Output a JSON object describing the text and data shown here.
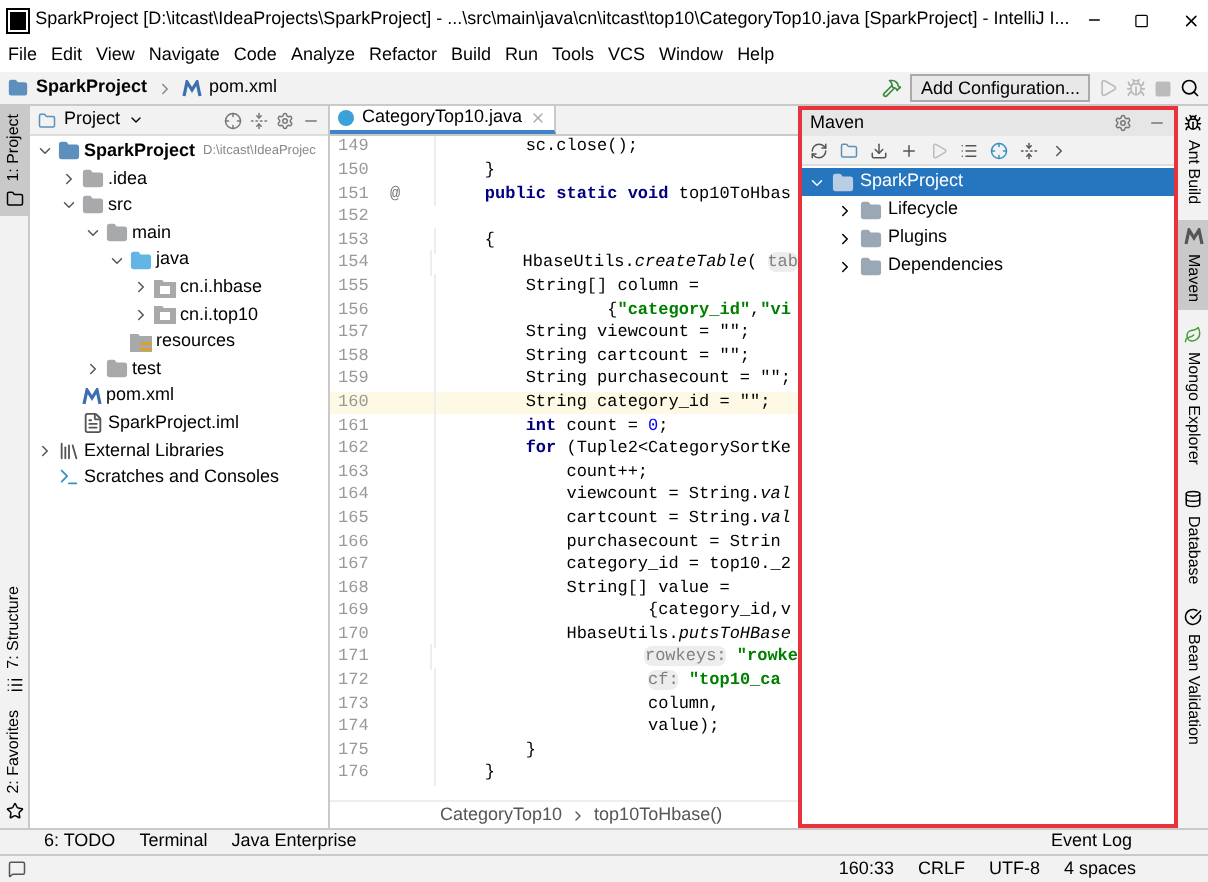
{
  "window": {
    "title": "SparkProject [D:\\itcast\\IdeaProjects\\SparkProject] - ...\\src\\main\\java\\cn\\itcast\\top10\\CategoryTop10.java [SparkProject] - IntelliJ I..."
  },
  "menu": [
    "File",
    "Edit",
    "View",
    "Navigate",
    "Code",
    "Analyze",
    "Refactor",
    "Build",
    "Run",
    "Tools",
    "VCS",
    "Window",
    "Help"
  ],
  "navbar": {
    "project": "SparkProject",
    "file": "pom.xml",
    "run_config": "Add Configuration..."
  },
  "left_tabs": [
    {
      "label": "1: Project",
      "selected": true
    },
    {
      "label": "7: Structure",
      "selected": false
    },
    {
      "label": "2: Favorites",
      "selected": false
    }
  ],
  "project_panel": {
    "title": "Project",
    "tree": [
      {
        "label": "SparkProject",
        "path": "D:\\itcast\\IdeaProjec",
        "kind": "module",
        "expanded": true,
        "children": [
          {
            "label": ".idea",
            "kind": "folder",
            "expanded": false
          },
          {
            "label": "src",
            "kind": "folder",
            "expanded": true,
            "children": [
              {
                "label": "main",
                "kind": "folder",
                "expanded": true,
                "children": [
                  {
                    "label": "java",
                    "kind": "source",
                    "expanded": true,
                    "children": [
                      {
                        "label": "cn.i.hbase",
                        "kind": "package",
                        "expanded": false
                      },
                      {
                        "label": "cn.i.top10",
                        "kind": "package",
                        "expanded": false
                      }
                    ]
                  },
                  {
                    "label": "resources",
                    "kind": "resources"
                  }
                ]
              },
              {
                "label": "test",
                "kind": "folder",
                "expanded": false
              }
            ]
          },
          {
            "label": "pom.xml",
            "kind": "maven"
          },
          {
            "label": "SparkProject.iml",
            "kind": "iml"
          }
        ]
      },
      {
        "label": "External Libraries",
        "kind": "libraries",
        "expanded": false
      },
      {
        "label": "Scratches and Consoles",
        "kind": "scratches"
      }
    ]
  },
  "editor": {
    "tab": "CategoryTop10.java",
    "lines": [
      {
        "n": "149",
        "code": [
          {
            "t": "        sc.close();",
            "kind": "plain"
          }
        ]
      },
      {
        "n": "150",
        "code": [
          {
            "t": "    }",
            "kind": "plain"
          }
        ]
      },
      {
        "n": "151",
        "mark": "@",
        "code": [
          {
            "t": "    public static void",
            "kind": "kw"
          },
          {
            "t": " top10ToHbas",
            "kind": "plain"
          }
        ]
      },
      {
        "n": "152"
      },
      {
        "n": "153",
        "code": [
          {
            "t": "    {",
            "kind": "plain"
          }
        ]
      },
      {
        "n": "154",
        "code": [
          {
            "t": "        HbaseUtils.",
            "kind": "plain"
          },
          {
            "t": "createTable",
            "kind": "ital"
          },
          {
            "t": "( ",
            "kind": "plain"
          },
          {
            "t": "tab",
            "kind": "hint"
          }
        ]
      },
      {
        "n": "155",
        "code": [
          {
            "t": "        String[] column =",
            "kind": "plain"
          }
        ]
      },
      {
        "n": "156",
        "code": [
          {
            "t": "                {",
            "kind": "plain"
          },
          {
            "t": "\"category_id\"",
            "kind": "str"
          },
          {
            "t": ",",
            "kind": "plain"
          },
          {
            "t": "\"vi",
            "kind": "str"
          }
        ]
      },
      {
        "n": "157",
        "code": [
          {
            "t": "        String viewcount = \"\";",
            "kind": "plain"
          }
        ]
      },
      {
        "n": "158",
        "code": [
          {
            "t": "        String cartcount = \"\";",
            "kind": "plain"
          }
        ]
      },
      {
        "n": "159",
        "code": [
          {
            "t": "        String purchasecount = \"\";",
            "kind": "plain"
          }
        ]
      },
      {
        "n": "160",
        "current": true,
        "code": [
          {
            "t": "        String category_id = \"\";",
            "kind": "plain"
          }
        ]
      },
      {
        "n": "161",
        "code": [
          {
            "t": "        int",
            "kind": "kw"
          },
          {
            "t": " count = ",
            "kind": "plain"
          },
          {
            "t": "0",
            "kind": "num"
          },
          {
            "t": ";",
            "kind": "plain"
          }
        ]
      },
      {
        "n": "162",
        "code": [
          {
            "t": "        for",
            "kind": "kw"
          },
          {
            "t": " (Tuple2<CategorySortKe",
            "kind": "plain"
          }
        ]
      },
      {
        "n": "163",
        "code": [
          {
            "t": "            count++;",
            "kind": "plain"
          }
        ]
      },
      {
        "n": "164",
        "code": [
          {
            "t": "            viewcount = String.",
            "kind": "plain"
          },
          {
            "t": "val",
            "kind": "ital"
          }
        ]
      },
      {
        "n": "165",
        "code": [
          {
            "t": "            cartcount = String.",
            "kind": "plain"
          },
          {
            "t": "val",
            "kind": "ital"
          }
        ]
      },
      {
        "n": "166",
        "code": [
          {
            "t": "            purchasecount = Strin",
            "kind": "plain"
          }
        ]
      },
      {
        "n": "167",
        "code": [
          {
            "t": "            category_id = top10._2",
            "kind": "plain"
          }
        ]
      },
      {
        "n": "168",
        "code": [
          {
            "t": "            String[] value =",
            "kind": "plain"
          }
        ]
      },
      {
        "n": "169",
        "code": [
          {
            "t": "                    {category_id,v",
            "kind": "plain"
          }
        ]
      },
      {
        "n": "170",
        "code": [
          {
            "t": "            HbaseUtils.",
            "kind": "plain"
          },
          {
            "t": "putsToHBase",
            "kind": "ital"
          }
        ]
      },
      {
        "n": "171",
        "code": [
          {
            "t": "                    rowkeys:",
            "kind": "hint"
          },
          {
            "t": " \"rowke",
            "kind": "str"
          }
        ]
      },
      {
        "n": "172",
        "code": [
          {
            "t": "                    cf:",
            "kind": "hint"
          },
          {
            "t": " \"top10_ca",
            "kind": "str"
          }
        ]
      },
      {
        "n": "173",
        "code": [
          {
            "t": "                    column,",
            "kind": "plain"
          }
        ]
      },
      {
        "n": "174",
        "code": [
          {
            "t": "                    value);",
            "kind": "plain"
          }
        ]
      },
      {
        "n": "175",
        "code": [
          {
            "t": "        }",
            "kind": "plain"
          }
        ]
      },
      {
        "n": "176",
        "code": [
          {
            "t": "    }",
            "kind": "plain"
          }
        ]
      }
    ],
    "breadcrumbs": [
      "CategoryTop10",
      "top10ToHbase()"
    ]
  },
  "maven_panel": {
    "title": "Maven",
    "tree": [
      {
        "label": "SparkProject",
        "selected": true,
        "expanded": true,
        "children": [
          {
            "label": "Lifecycle",
            "selected": false,
            "expanded": false
          },
          {
            "label": "Plugins",
            "selected": false,
            "expanded": false
          },
          {
            "label": "Dependencies",
            "selected": false,
            "expanded": false
          }
        ]
      }
    ]
  },
  "right_tabs": [
    {
      "label": "Ant Build",
      "selected": false
    },
    {
      "label": "Maven",
      "selected": true
    },
    {
      "label": "Mongo Explorer",
      "selected": false
    },
    {
      "label": "Database",
      "selected": false
    },
    {
      "label": "Bean Validation",
      "selected": false
    }
  ],
  "bottom_tabs": [
    "6: TODO",
    "Terminal",
    "Java Enterprise"
  ],
  "event_log": "Event Log",
  "status_bar": [
    "160:33",
    "CRLF",
    "UTF-8",
    "4 spaces"
  ]
}
